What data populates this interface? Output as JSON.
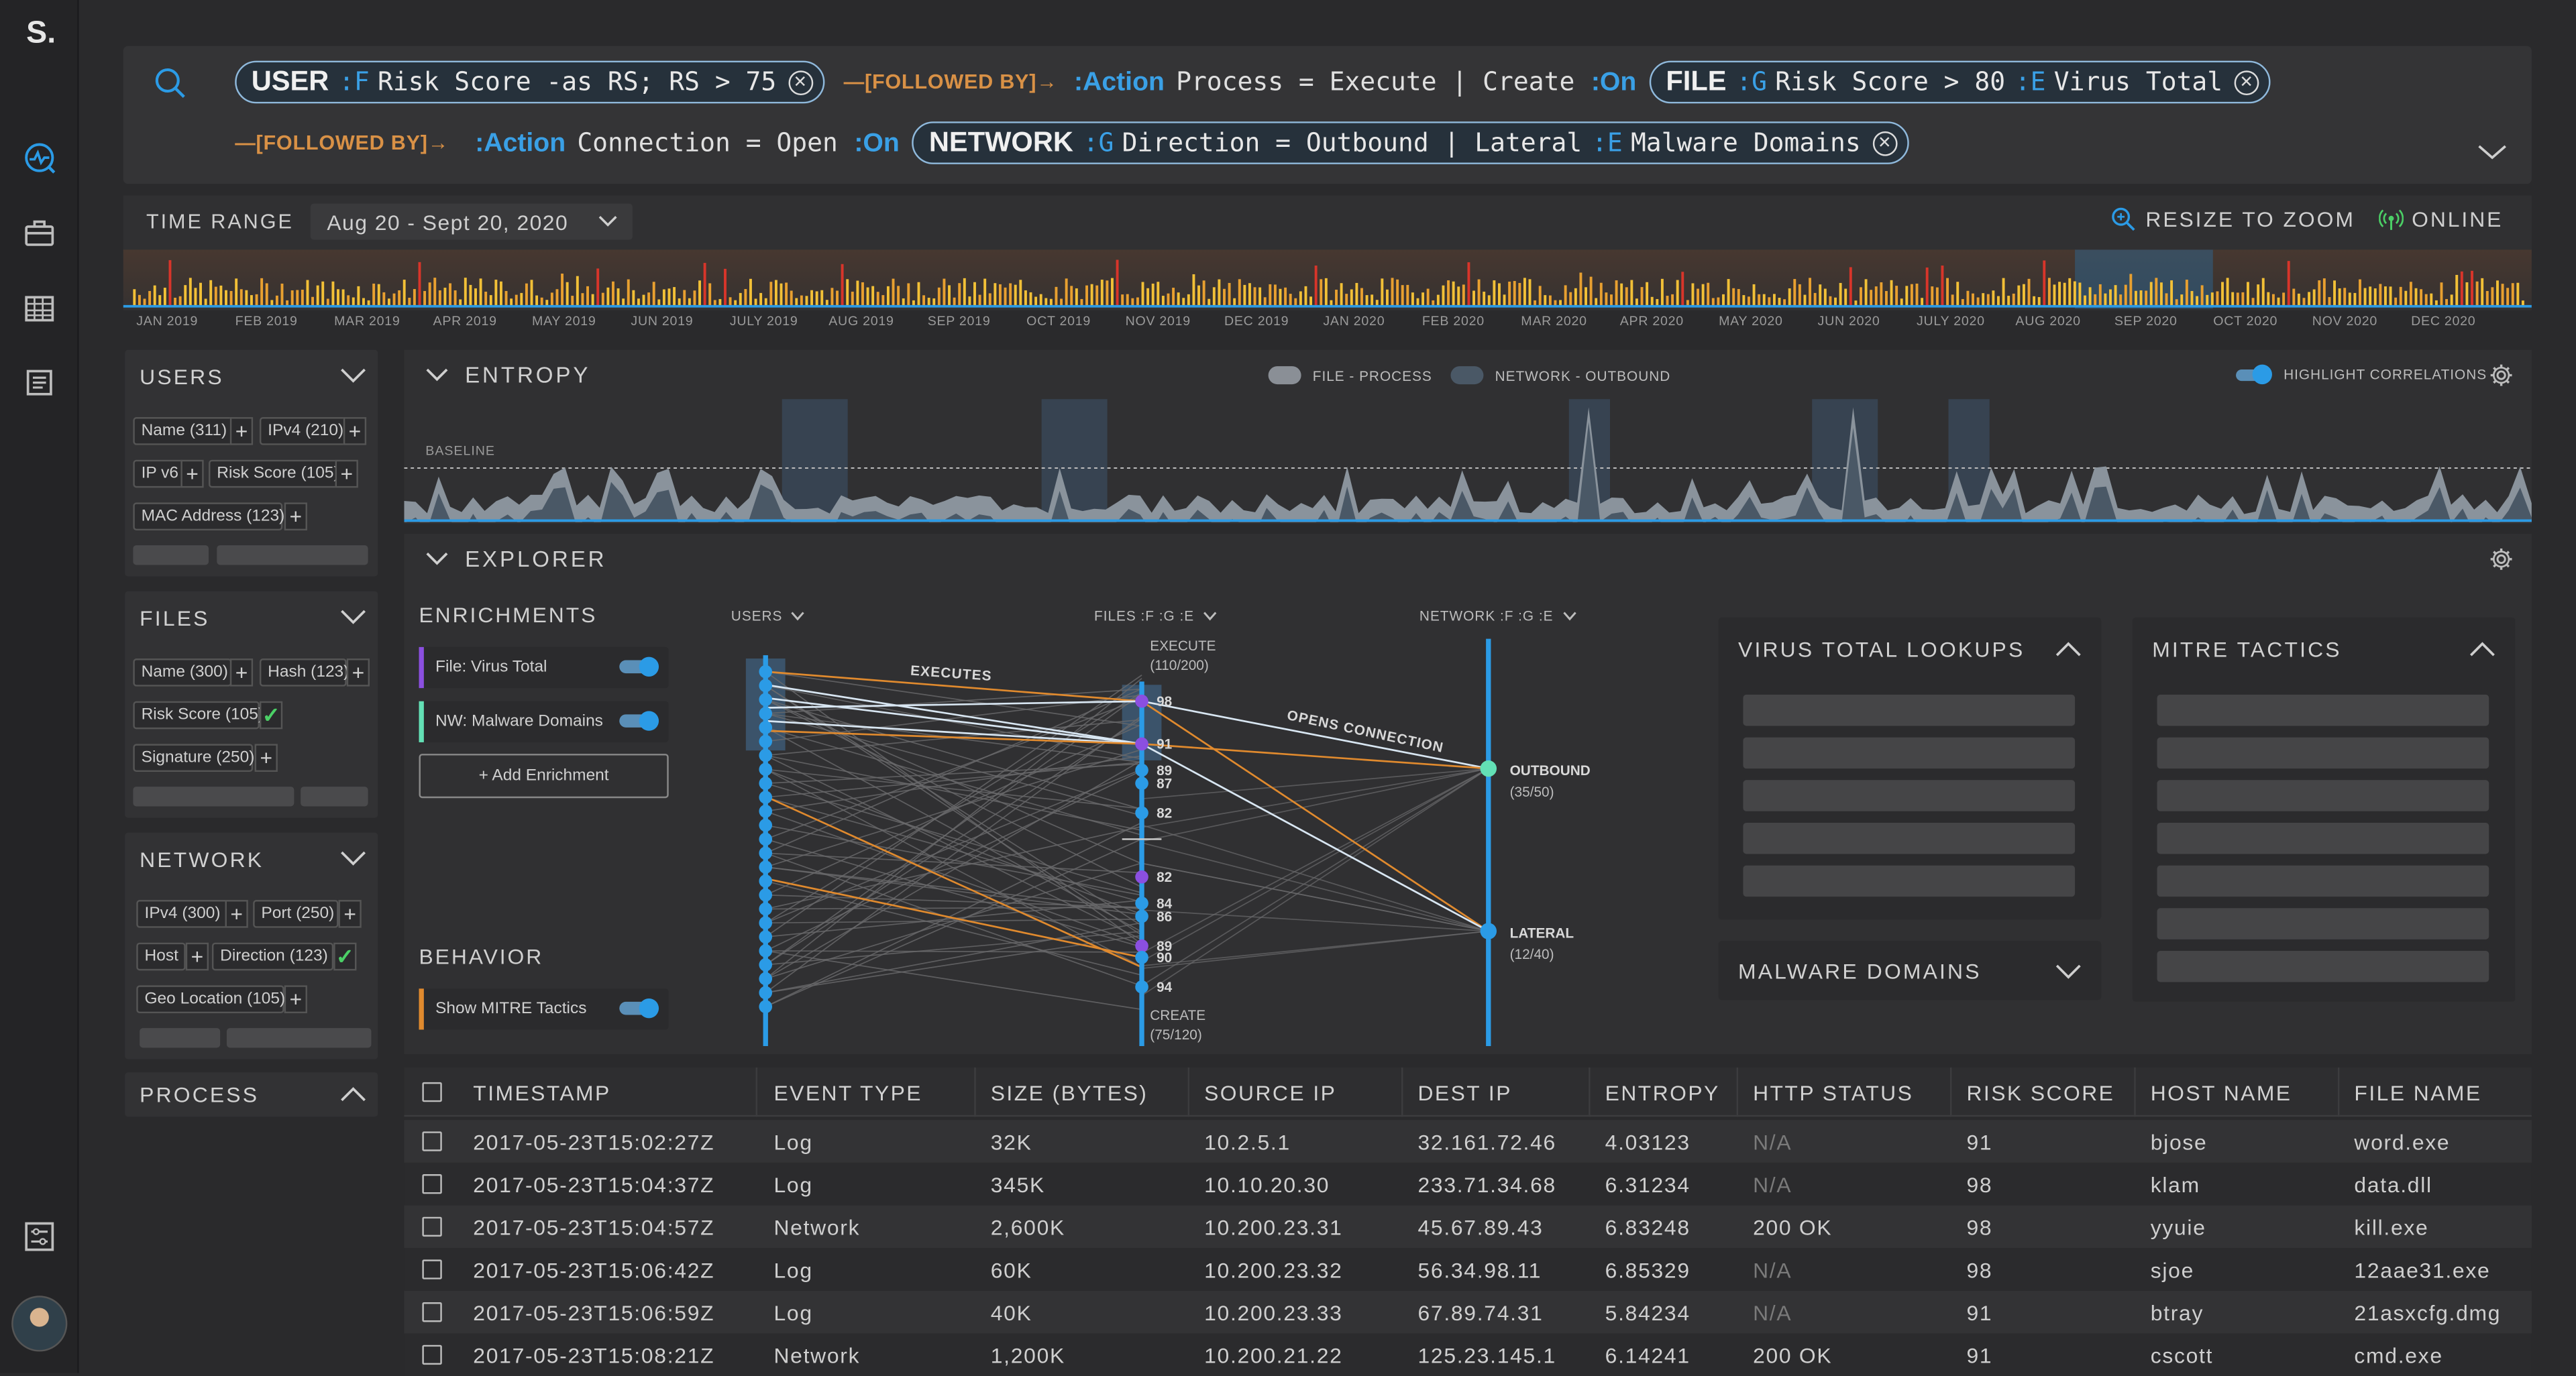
{
  "app": {
    "logo": "S."
  },
  "rail": {
    "icons": [
      "activity-icon",
      "briefcase-icon",
      "table-icon",
      "report-icon",
      "filters-icon"
    ]
  },
  "query": {
    "line1": {
      "pill1": {
        "entity": "USER",
        "tag": ":F",
        "expr": "Risk Score -as RS; RS > 75"
      },
      "followed": "—[FOLLOWED BY]→",
      "action_key": ":Action",
      "action_expr": "Process = Execute | Create",
      "on": ":On",
      "pill2": {
        "entity": "FILE",
        "tag": ":G",
        "expr": "Risk Score > 80",
        "tag2": ":E",
        "expr2": "Virus Total"
      }
    },
    "line2": {
      "followed": "—[FOLLOWED BY]→",
      "action_key": ":Action",
      "action_expr": "Connection = Open",
      "on": ":On",
      "pill3": {
        "entity": "NETWORK",
        "tag": ":G",
        "expr": "Direction = Outbound | Lateral",
        "tag2": ":E",
        "expr2": "Malware Domains"
      }
    }
  },
  "time": {
    "label": "TIME RANGE",
    "range": "Aug 20 - Sept 20, 2020",
    "zoom": "RESIZE TO ZOOM",
    "status": "ONLINE",
    "months": [
      "JAN 2019",
      "FEB 2019",
      "MAR 2019",
      "APR 2019",
      "MAY 2019",
      "JUN 2019",
      "JULY 2019",
      "AUG 2019",
      "SEP 2019",
      "OCT 2019",
      "NOV 2019",
      "DEC 2019",
      "JAN 2020",
      "FEB 2020",
      "MAR 2020",
      "APR 2020",
      "MAY 2020",
      "JUN 2020",
      "JULY 2020",
      "AUG 2020",
      "SEP 2020",
      "OCT 2020",
      "NOV 2020",
      "DEC 2020"
    ]
  },
  "filters": {
    "users": {
      "title": "USERS",
      "chips": [
        "Name (311)",
        "IPv4 (210)",
        "IP v6",
        "Risk Score (105)",
        "MAC Address (123)"
      ]
    },
    "files": {
      "title": "FILES",
      "chips": [
        "Name (300)",
        "Hash (123)",
        "Risk Score (105)",
        "Signature (250)"
      ]
    },
    "network": {
      "title": "NETWORK",
      "chips": [
        "IPv4 (300)",
        "Port (250)",
        "Host",
        "Direction (123)",
        "Geo Location (105)"
      ]
    },
    "process": {
      "title": "PROCESS"
    }
  },
  "entropy": {
    "title": "ENTROPY",
    "legend1": "FILE - PROCESS",
    "legend2": "NETWORK - OUTBOUND",
    "highlight": "HIGHLIGHT CORRELATIONS",
    "baseline": "BASELINE"
  },
  "explorer": {
    "title": "EXPLORER",
    "enrichments_title": "ENRICHMENTS",
    "enrich1": "File: Virus Total",
    "enrich2": "NW: Malware Domains",
    "add": "+ Add Enrichment",
    "behavior_title": "BEHAVIOR",
    "behavior1": "Show MITRE Tactics",
    "axis_users": "USERS",
    "axis_files": "FILES :F :G :E",
    "axis_network": "NETWORK :F :G :E",
    "executes": "EXECUTES",
    "opens": "OPENS CONNECTION",
    "execute": "EXECUTE",
    "execute_count": "(110/200)",
    "create": "CREATE",
    "create_count": "(75/120)",
    "outbound": "OUTBOUND",
    "outbound_count": "(35/50)",
    "lateral": "LATERAL",
    "lateral_count": "(12/40)",
    "file_scores": [
      "98",
      "91",
      "89",
      "87",
      "82",
      "82",
      "84",
      "86",
      "89",
      "90",
      "94"
    ],
    "vt_title": "VIRUS TOTAL LOOKUPS",
    "mitre_title": "MITRE TACTICS",
    "malware_title": "MALWARE DOMAINS"
  },
  "table": {
    "headers": [
      "TIMESTAMP",
      "EVENT TYPE",
      "SIZE (BYTES)",
      "SOURCE IP",
      "DEST IP",
      "ENTROPY",
      "HTTP STATUS",
      "RISK SCORE",
      "HOST NAME",
      "FILE NAME"
    ],
    "rows": [
      [
        "2017-05-23T15:02:27Z",
        "Log",
        "32K",
        "10.2.5.1",
        "32.161.72.46",
        "4.03123",
        "N/A",
        "91",
        "bjose",
        "word.exe"
      ],
      [
        "2017-05-23T15:04:37Z",
        "Log",
        "345K",
        "10.10.20.30",
        "233.71.34.68",
        "6.31234",
        "N/A",
        "98",
        "klam",
        "data.dll"
      ],
      [
        "2017-05-23T15:04:57Z",
        "Network",
        "2,600K",
        "10.200.23.31",
        "45.67.89.43",
        "6.83248",
        "200 OK",
        "98",
        "yyuie",
        "kill.exe"
      ],
      [
        "2017-05-23T15:06:42Z",
        "Log",
        "60K",
        "10.200.23.32",
        "56.34.98.11",
        "6.85329",
        "N/A",
        "98",
        "sjoe",
        "12aae31.exe"
      ],
      [
        "2017-05-23T15:06:59Z",
        "Log",
        "40K",
        "10.200.23.33",
        "67.89.74.31",
        "5.84234",
        "N/A",
        "91",
        "btray",
        "21asxcfg.dmg"
      ],
      [
        "2017-05-23T15:08:21Z",
        "Network",
        "1,200K",
        "10.200.21.22",
        "125.23.145.1",
        "6.14241",
        "200 OK",
        "91",
        "cscott",
        "cmd.exe"
      ]
    ]
  },
  "colors": {
    "accent": "#2b9be6",
    "orange": "#e08a2e",
    "purple": "#8b4fe0",
    "green": "#4bd066",
    "teal": "#63e0b5"
  }
}
